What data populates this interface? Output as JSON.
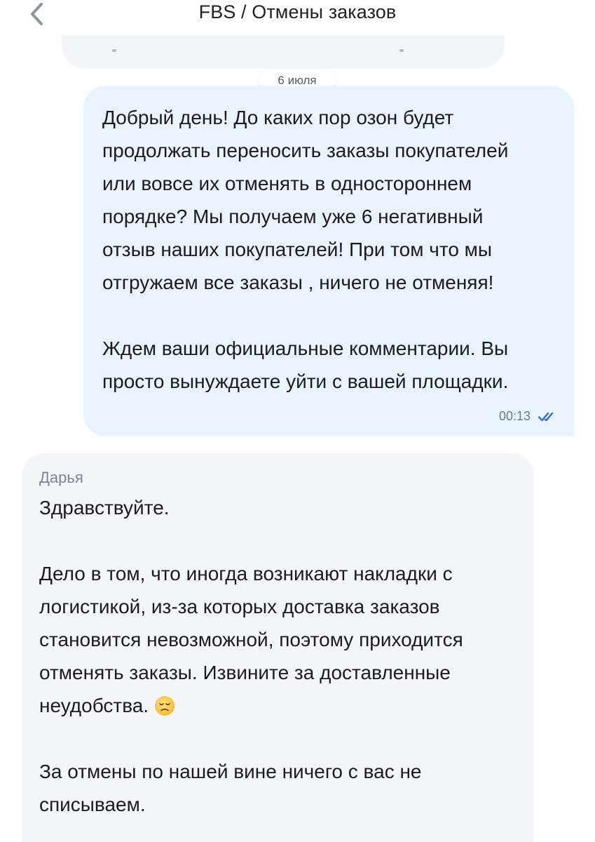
{
  "header": {
    "title": "FBS / Отмены заказов",
    "back_icon": "chevron-left-icon"
  },
  "date_separator": "6 июля",
  "outgoing_message": {
    "lines": [
      "Добрый день! До каких пор озон будет",
      "продолжать переносить заказы покупателей",
      "или вовсе их отменять в одностороннем",
      "порядке? Мы получаем уже 6 негативный",
      "отзыв наших покупателей! При том что мы",
      "отгружаем все заказы , ничего не отменяя!",
      "",
      "Ждем ваши официальные комментарии. Вы",
      "просто вынуждаете уйти с вашей площадки."
    ],
    "time": "00:13",
    "status_icon": "double-check-icon",
    "bubble_color": "#e8f3fe",
    "check_color": "#2f6bdc"
  },
  "incoming_message": {
    "sender": "Дарья",
    "lines": [
      "Здравствуйте.",
      "",
      "Дело в том, что иногда возникают накладки с",
      "логистикой, из-за которых доставка заказов",
      "становится невозможной, поэтому приходится",
      "отменять заказы. Извините за доставленные",
      "неудобства.",
      "",
      "За отмены по нашей вине ничего с вас не",
      "списываем."
    ],
    "emoji_icon": "disappointed-face-icon",
    "bubble_color": "#f3f5f8"
  }
}
